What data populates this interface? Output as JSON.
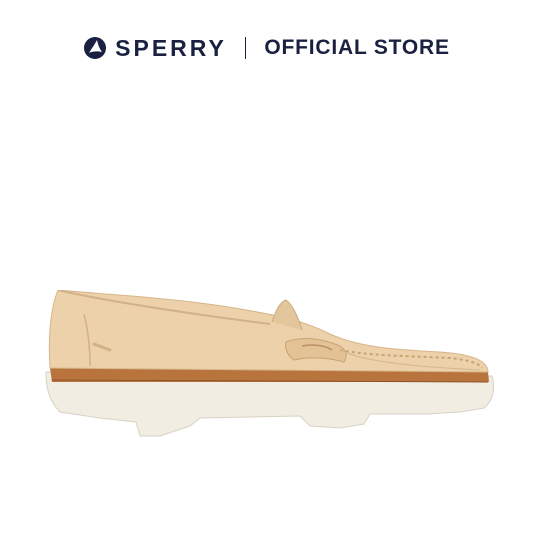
{
  "header": {
    "brand_name": "SPERRY",
    "store_label": "OFFICIAL STORE",
    "logo_icon": "sailboat-logo-icon"
  },
  "product": {
    "image_icon": "penny-loafer-shoe-image",
    "colors": {
      "upper": "#ecd1ab",
      "welt": "#b9743e",
      "sole": "#f1ede3"
    }
  },
  "colors": {
    "brand_navy": "#1a2140",
    "background": "#ffffff"
  }
}
